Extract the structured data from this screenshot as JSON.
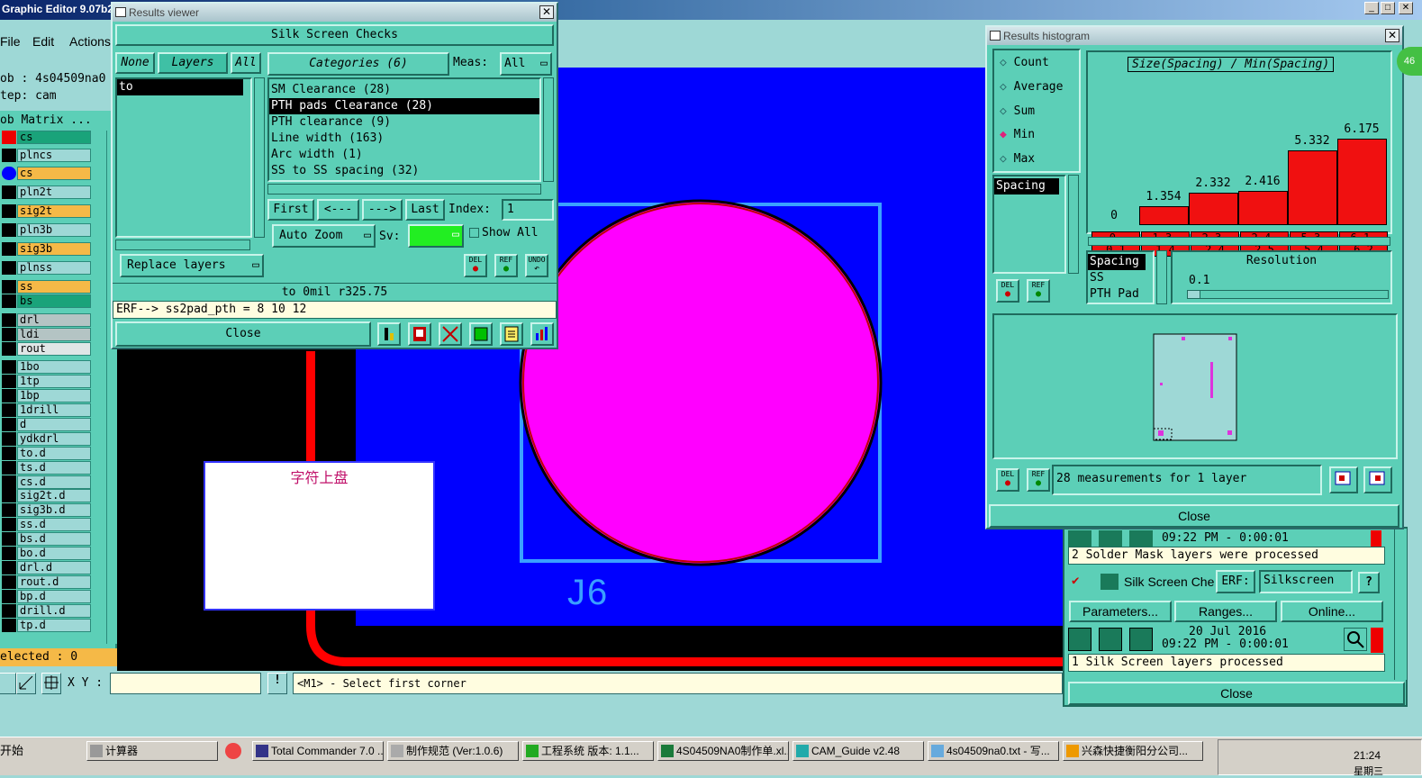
{
  "app": {
    "title": "Graphic Editor 9.07b2",
    "menu": [
      "File",
      "Edit",
      "Actions"
    ],
    "job_label": "ob : 4s04509na0",
    "step_label": "tep: cam",
    "matrix_label": "ob Matrix ...",
    "selected_label": "elected : 0",
    "xy_label": "X Y :",
    "status_message": "<M1> - Select first corner",
    "canvas_text_j6": "J6",
    "canvas_text_cn": "字符上盘"
  },
  "layers": [
    {
      "name": "cs",
      "style": "grn"
    },
    {
      "name": "plncs",
      "style": ""
    },
    {
      "name": "cs",
      "style": "org"
    },
    {
      "name": "pln2t",
      "style": ""
    },
    {
      "name": "sig2t",
      "style": "org"
    },
    {
      "name": "pln3b",
      "style": ""
    },
    {
      "name": "sig3b",
      "style": "org"
    },
    {
      "name": "plnss",
      "style": ""
    },
    {
      "name": "ss",
      "style": "org"
    },
    {
      "name": "bs",
      "style": "grn"
    },
    {
      "name": "drl",
      "style": "gry"
    },
    {
      "name": "ldi",
      "style": "gry"
    },
    {
      "name": "rout",
      "style": "ltg"
    },
    {
      "name": "1bo",
      "style": ""
    },
    {
      "name": "1tp",
      "style": ""
    },
    {
      "name": "1bp",
      "style": ""
    },
    {
      "name": "1drill",
      "style": ""
    },
    {
      "name": "d",
      "style": ""
    },
    {
      "name": "ydkdrl",
      "style": ""
    },
    {
      "name": "to.d",
      "style": ""
    },
    {
      "name": "ts.d",
      "style": ""
    },
    {
      "name": "cs.d",
      "style": ""
    },
    {
      "name": "sig2t.d",
      "style": ""
    },
    {
      "name": "sig3b.d",
      "style": ""
    },
    {
      "name": "ss.d",
      "style": ""
    },
    {
      "name": "bs.d",
      "style": ""
    },
    {
      "name": "bo.d",
      "style": ""
    },
    {
      "name": "drl.d",
      "style": ""
    },
    {
      "name": "rout.d",
      "style": ""
    },
    {
      "name": "bp.d",
      "style": ""
    },
    {
      "name": "drill.d",
      "style": ""
    },
    {
      "name": "tp.d",
      "style": ""
    }
  ],
  "results_viewer": {
    "title": "Results viewer",
    "header": "Silk Screen Checks",
    "none_btn": "None",
    "layers_btn": "Layers",
    "all_btn": "All",
    "categories_btn": "Categories (6)",
    "meas_label": "Meas:",
    "meas_value": "All",
    "layer_items": [
      "to"
    ],
    "categories": [
      "SM Clearance (28)",
      "PTH pads Clearance (28)",
      "PTH clearance (9)",
      "Line width (163)",
      "Arc width (1)",
      "SS to SS spacing (32)"
    ],
    "first_btn": "First",
    "prev_btn": "<---",
    "next_btn": "--->",
    "last_btn": "Last",
    "index_label": "Index:",
    "index_value": "1",
    "autozoom_btn": "Auto Zoom",
    "sv_label": "Sv:",
    "show_all_label": "Show All",
    "replace_btn": "Replace layers",
    "del_label": "DEL",
    "ref_label": "REF",
    "undo_label": "UNDO",
    "info_line": "to 0mil r325.75",
    "erf_line": "ERF--> ss2pad_pth = 8 10 12",
    "close_btn": "Close"
  },
  "histogram": {
    "title": "Results histogram",
    "options": [
      "Count",
      "Average",
      "Sum",
      "Min",
      "Max"
    ],
    "selected_option": "Min",
    "list_items": [
      "Spacing"
    ],
    "chart_title": "Size(Spacing) / Min(Spacing)",
    "del_label": "DEL",
    "ref_label": "REF",
    "type_items": [
      "Spacing",
      "SS",
      "PTH Pad"
    ],
    "resolution_label": "Resolution",
    "resolution_value": "0.1",
    "summary": "28 measurements for 1 layer",
    "close_btn": "Close",
    "badge": "46"
  },
  "chart_data": {
    "type": "bar",
    "title": "Size(Spacing) / Min(Spacing)",
    "categories": [
      "0-\n0.1",
      "1.3-\n1.4",
      "2.3-\n2.4",
      "2.4-\n2.5",
      "5.3-\n5.4",
      "6.1-\n6.2"
    ],
    "category_labels": [
      "0-0.1",
      "1.3-1.4",
      "2.3-2.4",
      "2.4-2.5",
      "5.3-5.4",
      "6.1-6.2"
    ],
    "values": [
      0,
      1.354,
      2.332,
      2.416,
      5.332,
      6.175
    ],
    "value_labels": [
      "0",
      "1.354",
      "2.332",
      "2.416",
      "5.332",
      "6.175"
    ],
    "ylim": [
      0,
      6.175
    ],
    "bar_color": "#f01010",
    "grid": false
  },
  "checklist": {
    "time_top": "09:22 PM - 0:00:01",
    "msg_top": "2 Solder Mask layers were processed",
    "check_name": "Silk Screen Che",
    "erf_label": "ERF:",
    "erf_value": "Silkscreen",
    "help": "?",
    "parameters_btn": "Parameters...",
    "ranges_btn": "Ranges...",
    "online_btn": "Online...",
    "date": "20 Jul 2016",
    "time_bottom": "09:22 PM - 0:00:01",
    "msg_bottom": "1 Silk Screen layers processed",
    "close_btn": "Close"
  },
  "taskbar": {
    "start": "开始",
    "items": [
      "计算器",
      "Total Commander 7.0 ...",
      "制作规范 (Ver:1.0.6)",
      "工程系统  版本: 1.1...",
      "4S04509NA0制作单.xl...",
      "CAM_Guide v2.48",
      "4s04509na0.txt - 写...",
      "兴森快捷衡阳分公司..."
    ],
    "clock": "21:24",
    "clock_sub": "星期三"
  }
}
